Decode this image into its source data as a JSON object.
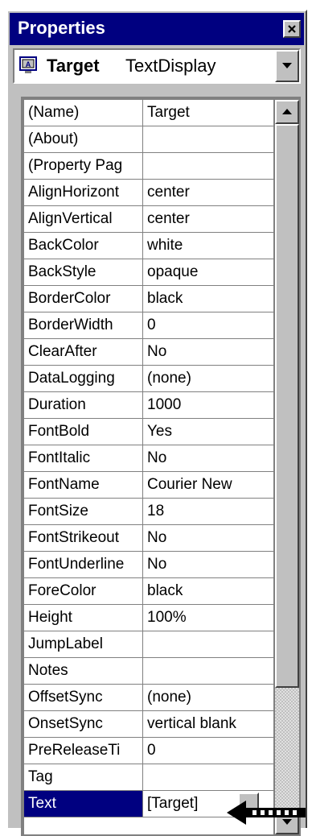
{
  "window": {
    "title": "Properties"
  },
  "object_selector": {
    "name": "Target",
    "type": "TextDisplay"
  },
  "properties": [
    {
      "name": "(Name)",
      "value": "Target"
    },
    {
      "name": "(About)",
      "value": ""
    },
    {
      "name": "(Property Pag",
      "value": ""
    },
    {
      "name": "AlignHorizont",
      "value": "center"
    },
    {
      "name": "AlignVertical",
      "value": "center"
    },
    {
      "name": "BackColor",
      "value": "white"
    },
    {
      "name": "BackStyle",
      "value": "opaque"
    },
    {
      "name": "BorderColor",
      "value": "black"
    },
    {
      "name": "BorderWidth",
      "value": "0"
    },
    {
      "name": "ClearAfter",
      "value": "No"
    },
    {
      "name": "DataLogging",
      "value": "(none)"
    },
    {
      "name": "Duration",
      "value": "1000"
    },
    {
      "name": "FontBold",
      "value": "Yes"
    },
    {
      "name": "FontItalic",
      "value": "No"
    },
    {
      "name": "FontName",
      "value": "Courier New"
    },
    {
      "name": "FontSize",
      "value": "18"
    },
    {
      "name": "FontStrikeout",
      "value": "No"
    },
    {
      "name": "FontUnderline",
      "value": "No"
    },
    {
      "name": "ForeColor",
      "value": "black"
    },
    {
      "name": "Height",
      "value": "100%"
    },
    {
      "name": "JumpLabel",
      "value": ""
    },
    {
      "name": "Notes",
      "value": ""
    },
    {
      "name": "OffsetSync",
      "value": "(none)"
    },
    {
      "name": "OnsetSync",
      "value": "vertical blank"
    },
    {
      "name": "PreReleaseTi",
      "value": "0"
    },
    {
      "name": "Tag",
      "value": ""
    },
    {
      "name": "Text",
      "value": "[Target]"
    }
  ],
  "selected_property": "Text",
  "colors": {
    "title_bar": "#000080",
    "selection": "#000080",
    "face": "#c0c0c0"
  }
}
